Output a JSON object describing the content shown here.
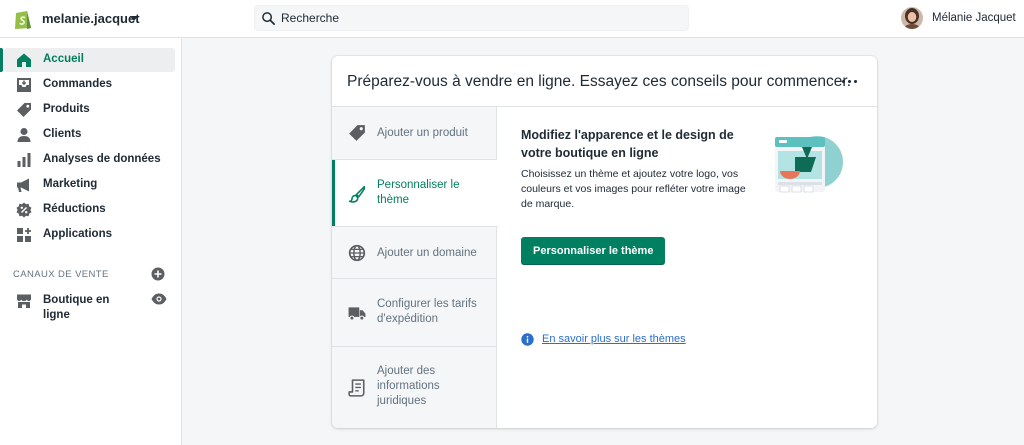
{
  "topbar": {
    "store_name": "melanie.jacquet",
    "search": {
      "placeholder": "Recherche"
    },
    "user_name": "Mélanie Jacquet"
  },
  "sidebar": {
    "items": [
      {
        "label": "Accueil",
        "icon": "home-icon",
        "active": true
      },
      {
        "label": "Commandes",
        "icon": "orders-icon"
      },
      {
        "label": "Produits",
        "icon": "tag-icon"
      },
      {
        "label": "Clients",
        "icon": "person-icon"
      },
      {
        "label": "Analyses de données",
        "icon": "bar-chart-icon"
      },
      {
        "label": "Marketing",
        "icon": "megaphone-icon"
      },
      {
        "label": "Réductions",
        "icon": "discount-icon"
      },
      {
        "label": "Applications",
        "icon": "apps-icon"
      }
    ],
    "sales_channels_title": "CANAUX DE VENTE",
    "channel": {
      "label": "Boutique en ligne",
      "icon": "store-icon"
    }
  },
  "card": {
    "title": "Préparez-vous à vendre en ligne. Essayez ces conseils pour commencer.",
    "tabs": [
      {
        "label": "Ajouter un produit",
        "icon": "tag-icon"
      },
      {
        "label": "Personnaliser le thème",
        "icon": "brush-icon",
        "active": true
      },
      {
        "label": "Ajouter un domaine",
        "icon": "globe-icon"
      },
      {
        "label": "Configurer les tarifs d'expédition",
        "icon": "truck-icon"
      },
      {
        "label": "Ajouter des informations juridiques",
        "icon": "document-icon"
      }
    ],
    "content": {
      "title": "Modifiez l'apparence et le design de votre boutique en ligne",
      "description": "Choisissez un thème et ajoutez votre logo, vos couleurs et vos images pour refléter votre image de marque.",
      "button": "Personnaliser le thème",
      "link": "En savoir plus sur les thèmes"
    }
  },
  "colors": {
    "accent": "#008060",
    "link": "#2c6ecb",
    "text": "#212b36",
    "muted": "#637381",
    "background": "#f4f6f8"
  }
}
